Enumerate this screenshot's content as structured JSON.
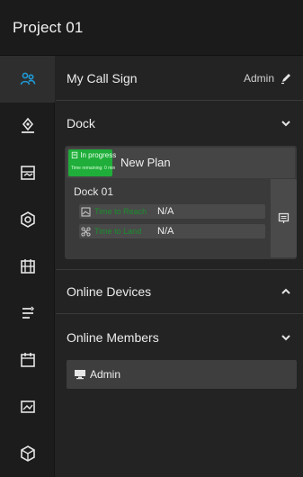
{
  "header": {
    "title": "Project 01"
  },
  "rail": {
    "items": [
      {
        "icon": "team-icon",
        "active": true
      },
      {
        "icon": "location-icon"
      },
      {
        "icon": "map-layer-icon"
      },
      {
        "icon": "camera-icon"
      },
      {
        "icon": "tasks-icon"
      },
      {
        "icon": "route-icon"
      },
      {
        "icon": "calendar-icon"
      },
      {
        "icon": "media-icon"
      },
      {
        "icon": "cube-icon"
      }
    ]
  },
  "call_sign": {
    "label": "My Call Sign",
    "value": "Admin"
  },
  "dock": {
    "label": "Dock",
    "plan": {
      "status": "In progress",
      "substatus": "Time remaining: 0 min",
      "name": "New Plan"
    },
    "dock_name": "Dock 01",
    "lines": [
      {
        "icon": "image-icon",
        "key": "Time to Reach",
        "value": "N/A"
      },
      {
        "icon": "drone-icon",
        "key": "Time to Land",
        "value": "N/A"
      }
    ]
  },
  "online_devices": {
    "label": "Online Devices"
  },
  "online_members": {
    "label": "Online Members",
    "members": [
      {
        "name": "Admin"
      }
    ]
  },
  "colors": {
    "accent_green": "#1fae3a",
    "background": "#232323",
    "panel": "#3a3a3a"
  }
}
